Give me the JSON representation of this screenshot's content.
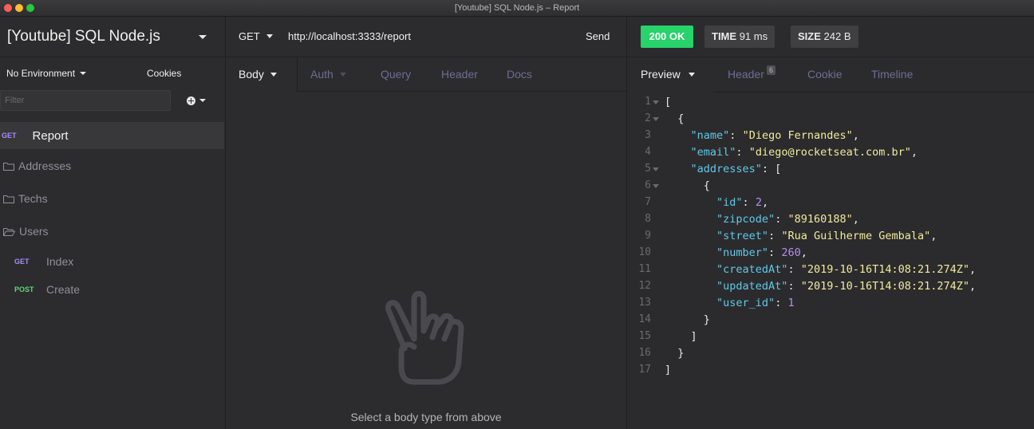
{
  "window": {
    "title": "[Youtube] SQL Node.js – Report"
  },
  "sidebar": {
    "workspace": "[Youtube] SQL Node.js",
    "environment": "No Environment",
    "cookies": "Cookies",
    "filter_placeholder": "Filter",
    "active_request": {
      "method": "GET",
      "name": "Report"
    },
    "folders": [
      {
        "name": "Addresses"
      },
      {
        "name": "Techs"
      },
      {
        "name": "Users",
        "items": [
          {
            "method": "GET",
            "name": "Index"
          },
          {
            "method": "POST",
            "name": "Create"
          }
        ]
      }
    ]
  },
  "request": {
    "method": "GET",
    "url": "http://localhost:3333/report",
    "send_label": "Send",
    "tabs": [
      "Body",
      "Auth",
      "Query",
      "Header",
      "Docs"
    ],
    "empty_message": "Select a body type from above"
  },
  "response": {
    "status": "200 OK",
    "time_label": "TIME",
    "time_value": "91 ms",
    "size_label": "SIZE",
    "size_value": "242 B",
    "tabs": [
      "Preview",
      "Header",
      "Cookie",
      "Timeline"
    ],
    "header_count": "6",
    "lines": [
      [
        {
          "t": "p",
          "v": "["
        }
      ],
      [
        {
          "t": "p",
          "v": "  {"
        }
      ],
      [
        {
          "t": "p",
          "v": "    "
        },
        {
          "t": "k",
          "v": "\"name\""
        },
        {
          "t": "p",
          "v": ": "
        },
        {
          "t": "s",
          "v": "\"Diego Fernandes\""
        },
        {
          "t": "p",
          "v": ","
        }
      ],
      [
        {
          "t": "p",
          "v": "    "
        },
        {
          "t": "k",
          "v": "\"email\""
        },
        {
          "t": "p",
          "v": ": "
        },
        {
          "t": "s",
          "v": "\"diego@rocketseat.com.br\""
        },
        {
          "t": "p",
          "v": ","
        }
      ],
      [
        {
          "t": "p",
          "v": "    "
        },
        {
          "t": "k",
          "v": "\"addresses\""
        },
        {
          "t": "p",
          "v": ": ["
        }
      ],
      [
        {
          "t": "p",
          "v": "      {"
        }
      ],
      [
        {
          "t": "p",
          "v": "        "
        },
        {
          "t": "k",
          "v": "\"id\""
        },
        {
          "t": "p",
          "v": ": "
        },
        {
          "t": "n",
          "v": "2"
        },
        {
          "t": "p",
          "v": ","
        }
      ],
      [
        {
          "t": "p",
          "v": "        "
        },
        {
          "t": "k",
          "v": "\"zipcode\""
        },
        {
          "t": "p",
          "v": ": "
        },
        {
          "t": "s",
          "v": "\"89160188\""
        },
        {
          "t": "p",
          "v": ","
        }
      ],
      [
        {
          "t": "p",
          "v": "        "
        },
        {
          "t": "k",
          "v": "\"street\""
        },
        {
          "t": "p",
          "v": ": "
        },
        {
          "t": "s",
          "v": "\"Rua Guilherme Gembala\""
        },
        {
          "t": "p",
          "v": ","
        }
      ],
      [
        {
          "t": "p",
          "v": "        "
        },
        {
          "t": "k",
          "v": "\"number\""
        },
        {
          "t": "p",
          "v": ": "
        },
        {
          "t": "n",
          "v": "260"
        },
        {
          "t": "p",
          "v": ","
        }
      ],
      [
        {
          "t": "p",
          "v": "        "
        },
        {
          "t": "k",
          "v": "\"createdAt\""
        },
        {
          "t": "p",
          "v": ": "
        },
        {
          "t": "s",
          "v": "\"2019-10-16T14:08:21.274Z\""
        },
        {
          "t": "p",
          "v": ","
        }
      ],
      [
        {
          "t": "p",
          "v": "        "
        },
        {
          "t": "k",
          "v": "\"updatedAt\""
        },
        {
          "t": "p",
          "v": ": "
        },
        {
          "t": "s",
          "v": "\"2019-10-16T14:08:21.274Z\""
        },
        {
          "t": "p",
          "v": ","
        }
      ],
      [
        {
          "t": "p",
          "v": "        "
        },
        {
          "t": "k",
          "v": "\"user_id\""
        },
        {
          "t": "p",
          "v": ": "
        },
        {
          "t": "n",
          "v": "1"
        }
      ],
      [
        {
          "t": "p",
          "v": "      }"
        }
      ],
      [
        {
          "t": "p",
          "v": "    ]"
        }
      ],
      [
        {
          "t": "p",
          "v": "  }"
        }
      ],
      [
        {
          "t": "p",
          "v": "]"
        }
      ]
    ],
    "fold_lines": [
      1,
      2,
      5,
      6
    ]
  }
}
